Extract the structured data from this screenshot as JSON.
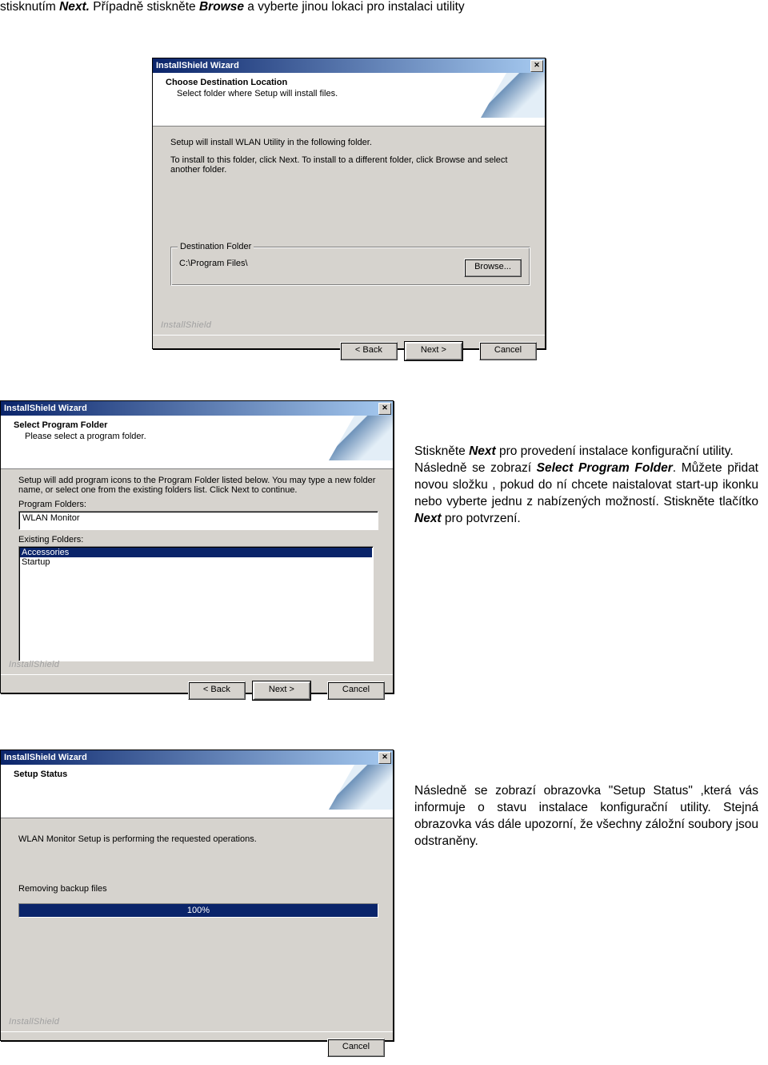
{
  "doc": {
    "top_text_1": "stisknutím ",
    "top_text_2": "Next.",
    "top_text_3": " Případně stiskněte ",
    "top_text_4": "Browse",
    "top_text_5": " a vyberte jinou lokaci pro instalaci utility"
  },
  "dlg1": {
    "title": "InstallShield Wizard",
    "banner_title": "Choose Destination Location",
    "banner_sub": "Select folder where Setup will install files.",
    "line1": "Setup will install WLAN Utility in the following folder.",
    "line2": "To install to this folder, click Next. To install to a different folder, click Browse and select another folder.",
    "group_label": "Destination Folder",
    "path": "C:\\Program Files\\",
    "browse": "Browse...",
    "ishield": "InstallShield",
    "back": "< Back",
    "next": "Next >",
    "cancel": "Cancel"
  },
  "dlg2": {
    "title": "InstallShield Wizard",
    "banner_title": "Select Program Folder",
    "banner_sub": "Please select a program folder.",
    "desc": "Setup will add program icons to the Program Folder listed below.  You may type a new folder name, or select one from the existing folders list.  Click Next to continue.",
    "label_pf": "Program Folders:",
    "pf_value": "WLAN Monitor",
    "label_ef": "Existing Folders:",
    "ef_sel": "Accessories",
    "ef_1": "Startup",
    "ishield": "InstallShield",
    "back": "< Back",
    "next": "Next >",
    "cancel": "Cancel"
  },
  "dlg3": {
    "title": "InstallShield Wizard",
    "banner_title": "Setup Status",
    "status_line": "WLAN Monitor Setup is performing the requested operations.",
    "action_line": "Removing backup files",
    "percent": "100%",
    "ishield": "InstallShield",
    "cancel": "Cancel"
  },
  "para1": {
    "s1": "Stiskněte ",
    "s2": "Next",
    "s3": " pro provedení instalace konfigurační utility.",
    "s4": "Následně se zobrazí ",
    "s5": "Select Program Folder",
    "s6": ". Můžete přidat novou složku , pokud do ní chcete naistalovat start-up ikonku nebo vyberte jednu z nabízených možností. Stiskněte tlačítko ",
    "s7": "Next",
    "s8": " pro potvrzení."
  },
  "para2": {
    "t1": "Následně se zobrazí obrazovka \"Setup Status\" ,která vás informuje o stavu instalace konfigurační utility. Stejná obrazovka vás dále upozorní, že všechny záložní soubory jsou odstraněny."
  }
}
